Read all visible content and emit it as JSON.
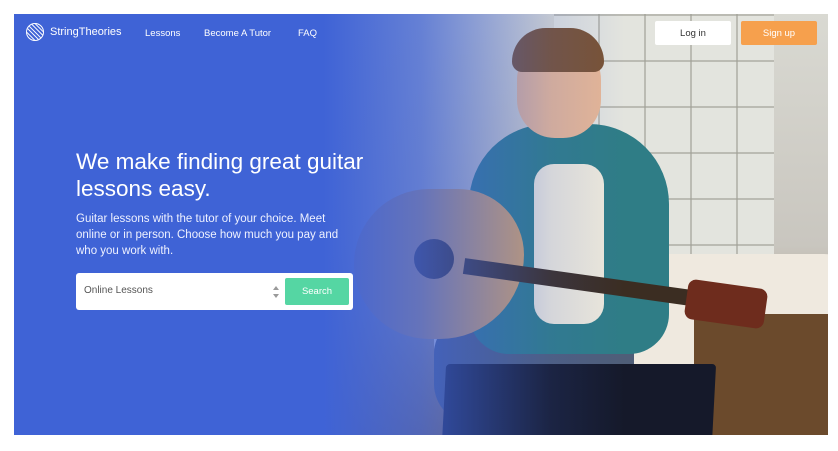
{
  "brand": {
    "name": "StringTheories"
  },
  "nav": {
    "links": [
      "Lessons",
      "Become A Tutor",
      "FAQ"
    ],
    "login_label": "Log in",
    "signup_label": "Sign up"
  },
  "hero": {
    "headline": "We make finding great guitar lessons easy.",
    "subtext": "Guitar lessons with the tutor of your choice. Meet online or in person. Choose how much you pay and who you work with."
  },
  "search": {
    "selected_option": "Online Lessons",
    "button_label": "Search"
  },
  "colors": {
    "hero_blue": "#3f63d6",
    "signup_orange": "#f6a04d",
    "search_green": "#55d6a3"
  }
}
